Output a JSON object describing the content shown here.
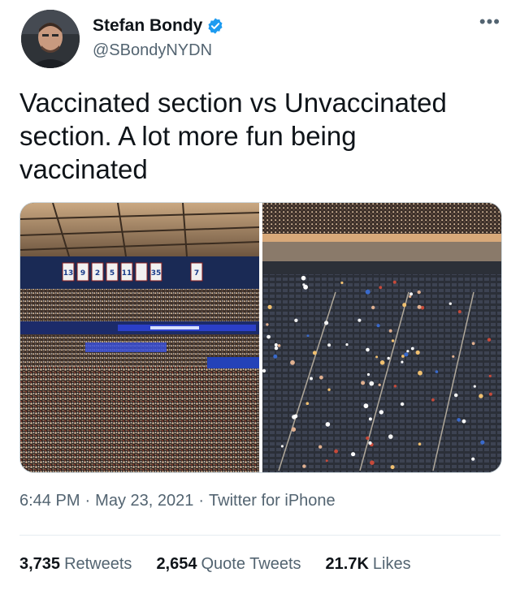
{
  "author": {
    "name": "Stefan Bondy",
    "handle": "@SBondyNYDN",
    "verified": true,
    "avatar_icon": "profile-photo"
  },
  "more_icon": "more-horizontal-icon",
  "tweet": {
    "text": "Vaccinated section vs Unvaccinated section. A lot more fun being vaccinated"
  },
  "media": {
    "left_banner_numbers": [
      "13",
      "9",
      "2",
      "5",
      "11",
      "35",
      "7"
    ],
    "right_description": "sparse seating"
  },
  "meta": {
    "time": "6:44 PM",
    "date": "May 23, 2021",
    "source": "Twitter for iPhone",
    "separator": "·"
  },
  "stats": {
    "retweets": {
      "count": "3,735",
      "label": "Retweets"
    },
    "quotes": {
      "count": "2,654",
      "label": "Quote Tweets"
    },
    "likes": {
      "count": "21.7K",
      "label": "Likes"
    }
  },
  "colors": {
    "text": "#0f1419",
    "secondary": "#536471",
    "verified": "#1d9bf0",
    "border": "#cfd9de"
  }
}
